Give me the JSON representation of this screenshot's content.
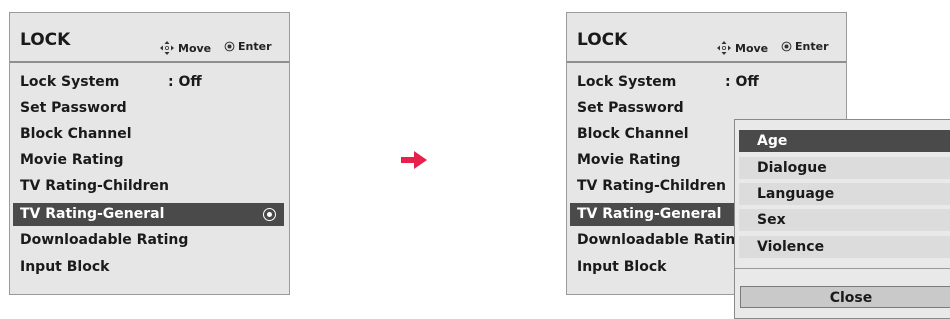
{
  "left_panel": {
    "title": "LOCK",
    "hints": {
      "move_label": "Move",
      "enter_label": "Enter"
    },
    "items": [
      {
        "label": "Lock System",
        "value": ": Off"
      },
      {
        "label": "Set Password"
      },
      {
        "label": "Block Channel"
      },
      {
        "label": "Movie Rating"
      },
      {
        "label": "TV Rating-Children"
      },
      {
        "label": "TV Rating-General",
        "selected": true
      },
      {
        "label": "Downloadable Rating"
      },
      {
        "label": "Input Block"
      }
    ]
  },
  "right_panel": {
    "title": "LOCK",
    "hints": {
      "move_label": "Move",
      "enter_label": "Enter"
    },
    "items": [
      {
        "label": "Lock System",
        "value": ": Off"
      },
      {
        "label": "Set Password"
      },
      {
        "label": "Block Channel"
      },
      {
        "label": "Movie Rating"
      },
      {
        "label": "TV Rating-Children"
      },
      {
        "label": "TV Rating-General",
        "selected": true
      },
      {
        "label": "Downloadable Rating"
      },
      {
        "label": "Input Block"
      }
    ],
    "popup": {
      "items": [
        {
          "label": "Age",
          "selected": true
        },
        {
          "label": "Dialogue"
        },
        {
          "label": "Language"
        },
        {
          "label": "Sex"
        },
        {
          "label": "Violence"
        }
      ],
      "close_label": "Close"
    }
  },
  "transition_icon": "right-arrow-icon",
  "colors": {
    "accent": "#e8204c",
    "selected_bg": "#4a4a4a",
    "panel_bg": "#e6e6e6"
  }
}
